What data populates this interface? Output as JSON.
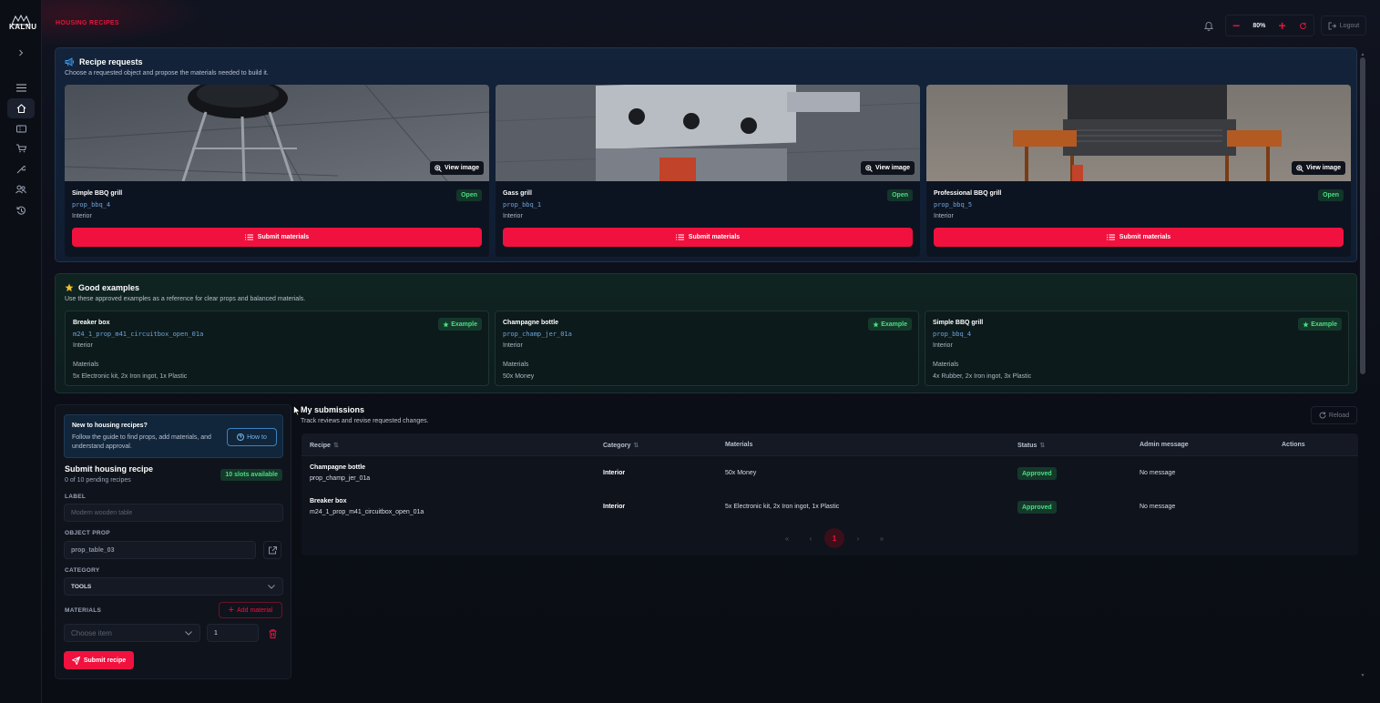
{
  "app": {
    "logo_text": "KALNU",
    "page_title": "HOUSING RECIPES"
  },
  "topbar": {
    "zoom": "80%",
    "logout_label": "Logout"
  },
  "sidebar": {
    "items": [
      "expand",
      "list",
      "home",
      "tickets",
      "cart",
      "tools",
      "users",
      "history"
    ]
  },
  "requests": {
    "title": "Recipe requests",
    "subtitle": "Choose a requested object and propose the materials needed to build it.",
    "view_label": "View image",
    "submit_label": "Submit materials",
    "cards": [
      {
        "name": "Simple BBQ grill",
        "prop": "prop_bbq_4",
        "category": "Interior",
        "status": "Open"
      },
      {
        "name": "Gass grill",
        "prop": "prop_bbq_1",
        "category": "Interior",
        "status": "Open"
      },
      {
        "name": "Professional BBQ grill",
        "prop": "prop_bbq_5",
        "category": "Interior",
        "status": "Open"
      }
    ]
  },
  "examples": {
    "title": "Good examples",
    "subtitle": "Use these approved examples as a reference for clear props and balanced materials.",
    "badge": "Example",
    "materials_label": "Materials",
    "cards": [
      {
        "name": "Breaker box",
        "prop": "m24_1_prop_m41_circuitbox_open_01a",
        "category": "Interior",
        "materials": "5x Electronic kit, 2x Iron ingot, 1x Plastic"
      },
      {
        "name": "Champagne bottle",
        "prop": "prop_champ_jer_01a",
        "category": "Interior",
        "materials": "50x Money"
      },
      {
        "name": "Simple BBQ grill",
        "prop": "prop_bbq_4",
        "category": "Interior",
        "materials": "4x Rubber, 2x Iron ingot, 3x Plastic"
      }
    ]
  },
  "form": {
    "help_title": "New to housing recipes?",
    "help_text": "Follow the guide to find props, add materials, and understand approval.",
    "howto_label": "How to",
    "title": "Submit housing recipe",
    "pending": "0 of 10 pending recipes",
    "slots": "10 slots available",
    "label_label": "LABEL",
    "label_placeholder": "Modern wooden table",
    "prop_label": "OBJECT PROP",
    "prop_placeholder": "prop_table_03",
    "category_label": "CATEGORY",
    "category_value": "TOOLS",
    "materials_label": "MATERIALS",
    "add_material": "Add material",
    "item_placeholder": "Choose item",
    "quantity": "1",
    "submit_label": "Submit recipe"
  },
  "submissions": {
    "title": "My submissions",
    "subtitle": "Track reviews and revise requested changes.",
    "reload_label": "Reload",
    "columns": [
      "Recipe",
      "Category",
      "Materials",
      "Status",
      "Admin message",
      "Actions"
    ],
    "rows": [
      {
        "name": "Champagne bottle",
        "prop": "prop_champ_jer_01a",
        "category": "Interior",
        "materials": "50x Money",
        "status": "Approved",
        "message": "No message"
      },
      {
        "name": "Breaker box",
        "prop": "m24_1_prop_m41_circuitbox_open_01a",
        "category": "Interior",
        "materials": "5x Electronic kit, 2x Iron ingot, 1x Plastic",
        "status": "Approved",
        "message": "No message"
      }
    ],
    "page": "1"
  },
  "colors": {
    "accent": "#f0113f",
    "success": "#4ade80",
    "link": "#6fa3d8"
  }
}
